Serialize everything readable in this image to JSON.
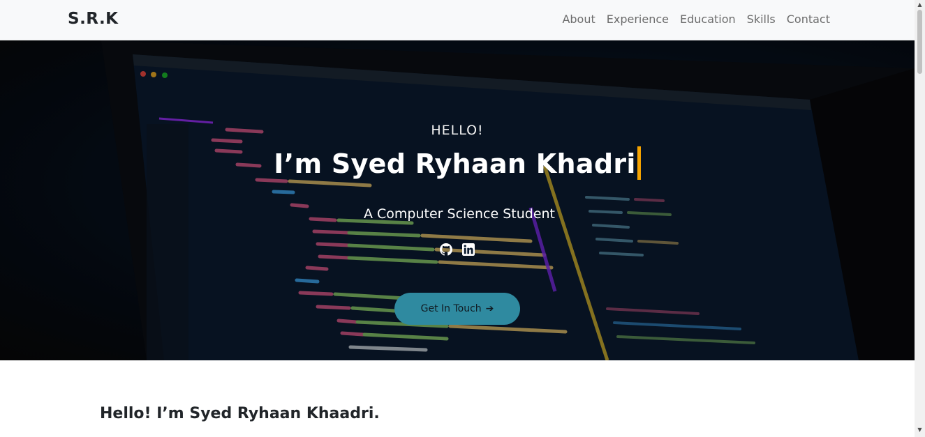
{
  "navbar": {
    "brand": "S.R.K",
    "links": [
      "About",
      "Experience",
      "Education",
      "Skills",
      "Contact"
    ]
  },
  "hero": {
    "greeting": "HELLO!",
    "headline": "I’m Syed Ryhaan Khadri",
    "subtitle": "A Computer Science Student",
    "socials": [
      "github-icon",
      "linkedin-icon"
    ],
    "cta_label": "Get In Touch",
    "cta_icon": "arrow-right-icon"
  },
  "about": {
    "title": "Hello! I’m Syed Ryhaan Khaadri."
  },
  "colors": {
    "accent": "#2f8aa0",
    "cursor": "#f5a300",
    "navbar_bg": "#f8f9fa"
  }
}
